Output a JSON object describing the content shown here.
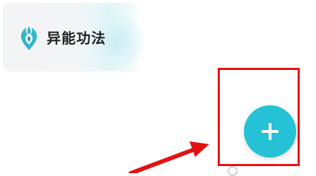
{
  "card": {
    "title": "异能功法",
    "icon": "flame-emblem-icon"
  },
  "fab": {
    "icon": "plus-icon",
    "color": "#25c2d6"
  },
  "annotation": {
    "box_color": "#e31212",
    "arrow_color": "#e31212"
  }
}
